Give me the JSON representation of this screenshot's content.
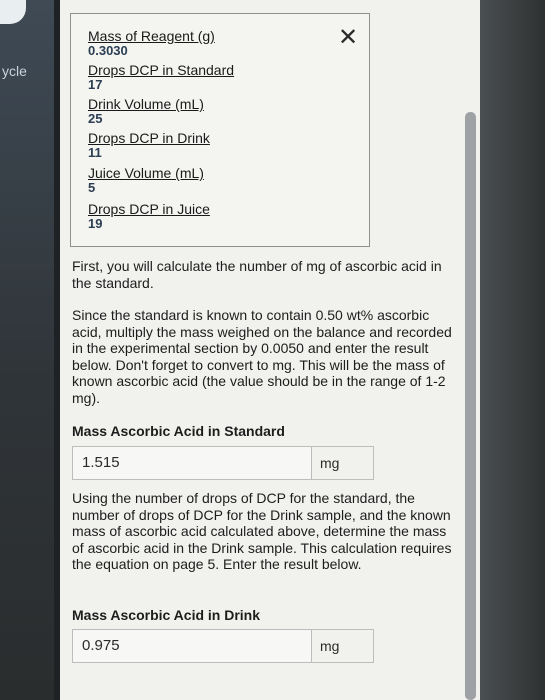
{
  "left_sidebar": {
    "partial_text": "ycle"
  },
  "data_panel": {
    "close_symbol": "✕",
    "fields": [
      {
        "label": "Mass of Reagent (g)",
        "value": "0.3030"
      },
      {
        "label": "Drops DCP in Standard",
        "value": "17"
      },
      {
        "label": "Drink Volume (mL)",
        "value": "25"
      },
      {
        "label": "Drops DCP in Drink",
        "value": "11"
      },
      {
        "label": "Juice Volume (mL)",
        "value": "5"
      },
      {
        "label": "Drops DCP in Juice",
        "value": "19"
      }
    ]
  },
  "instructions": {
    "intro": "First, you will calculate the number of mg of ascorbic acid in the standard.",
    "standard_text": "Since the standard is known to contain 0.50 wt% ascorbic acid, multiply the mass weighed on the balance and recorded in the experimental section by 0.0050 and enter the result below. Don't forget to convert to mg. This will be the mass of known ascorbic acid (the value should be in the range of 1-2 mg).",
    "drink_text": "Using the number of drops of DCP for the standard, the number of drops of DCP for the Drink sample, and the known mass of ascorbic acid calculated above, determine the mass of ascorbic acid in the Drink sample. This calculation requires the equation on page 5. Enter the result below."
  },
  "standard_answer": {
    "label": "Mass Ascorbic Acid in Standard",
    "value": "1.515",
    "unit": "mg"
  },
  "drink_answer": {
    "label": "Mass Ascorbic Acid in Drink",
    "value": "0.975",
    "unit": "mg"
  }
}
